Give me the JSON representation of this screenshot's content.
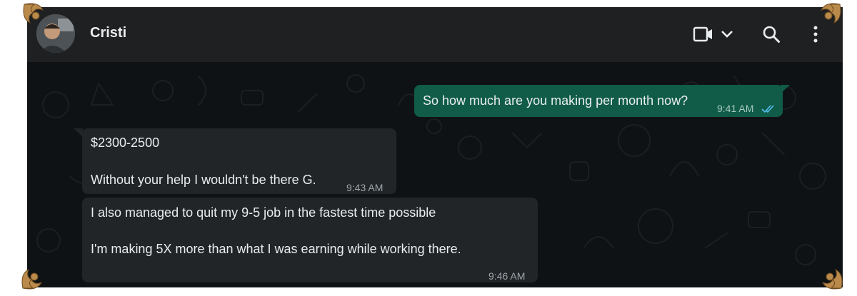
{
  "header": {
    "contact_name": "Cristi"
  },
  "messages": [
    {
      "direction": "outgoing",
      "lines": [
        "So how much are you making per month now?"
      ],
      "time": "9:41 AM",
      "status": "read-double-check"
    },
    {
      "direction": "incoming",
      "lines": [
        "$2300-2500",
        "Without your help I wouldn't be there G."
      ],
      "time": "9:43 AM"
    },
    {
      "direction": "incoming",
      "lines": [
        "I also managed to quit my 9-5 job in the fastest time possible",
        "I'm making 5X more than what I was earning while working there."
      ],
      "time": "9:46 AM"
    }
  ],
  "icons": {
    "video": "video-camera-icon",
    "dropdown": "chevron-down-icon",
    "search": "search-icon",
    "menu": "kebab-menu-icon",
    "read_status": "double-check-icon"
  },
  "colors": {
    "header_bg": "#1e2022",
    "chat_bg": "#0f1214",
    "outgoing_bubble": "#105c48",
    "incoming_bubble": "#222527",
    "read_tick": "#53bdeb",
    "ornament": "#b98a4a"
  }
}
